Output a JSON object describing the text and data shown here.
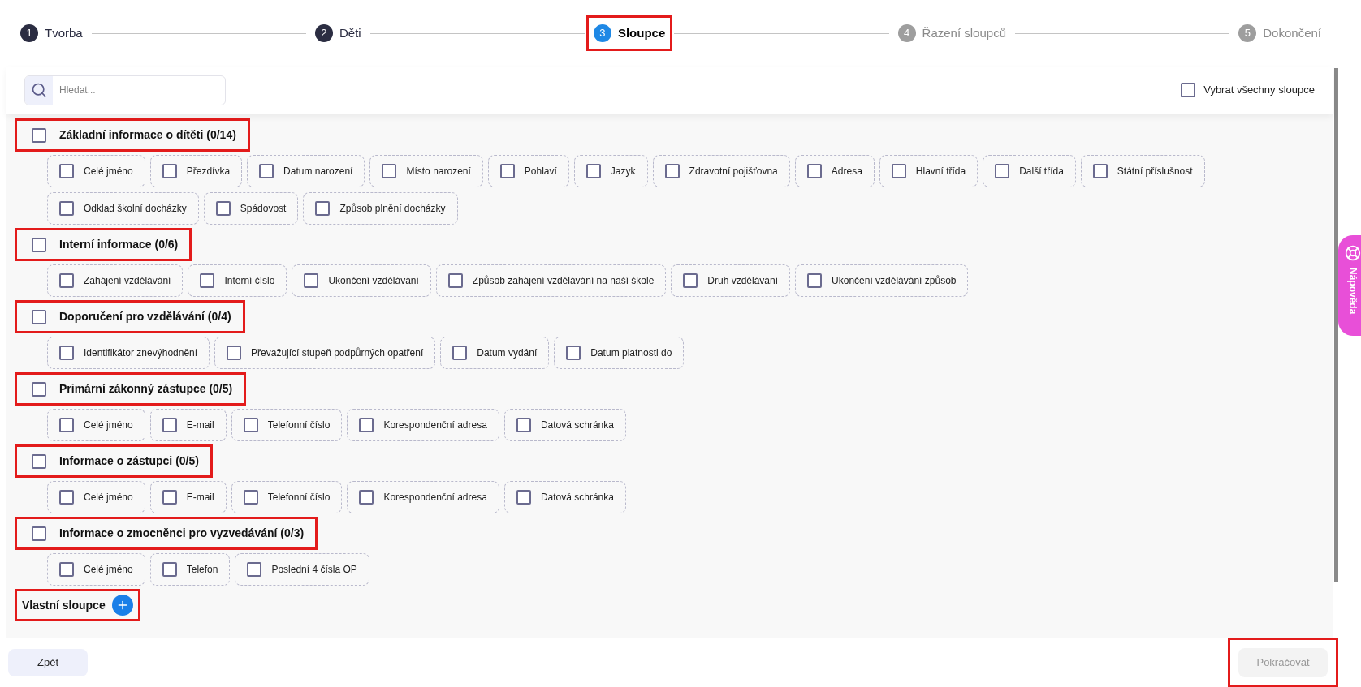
{
  "steps": [
    {
      "number": "1",
      "label": "Tvorba",
      "kind": "done",
      "highlighted": false
    },
    {
      "number": "2",
      "label": "Děti",
      "kind": "done",
      "highlighted": false
    },
    {
      "number": "3",
      "label": "Sloupce",
      "kind": "active",
      "highlighted": true
    },
    {
      "number": "4",
      "label": "Řazení sloupců",
      "kind": "pending",
      "highlighted": false
    },
    {
      "number": "5",
      "label": "Dokončení",
      "kind": "pending",
      "highlighted": false
    }
  ],
  "search": {
    "placeholder": "Hledat..."
  },
  "select_all": {
    "label": "Vybrat všechny sloupce",
    "checked": false
  },
  "sections": [
    {
      "title": "Základní informace o dítěti (0/14)",
      "checked": false,
      "highlighted": true,
      "columns": [
        {
          "label": "Celé jméno",
          "checked": false
        },
        {
          "label": "Přezdívka",
          "checked": false
        },
        {
          "label": "Datum narození",
          "checked": false
        },
        {
          "label": "Místo narození",
          "checked": false
        },
        {
          "label": "Pohlaví",
          "checked": false
        },
        {
          "label": "Jazyk",
          "checked": false
        },
        {
          "label": "Zdravotní pojišťovna",
          "checked": false
        },
        {
          "label": "Adresa",
          "checked": false
        },
        {
          "label": "Hlavní třída",
          "checked": false
        },
        {
          "label": "Další třída",
          "checked": false
        },
        {
          "label": "Státní příslušnost",
          "checked": false
        },
        {
          "label": "Odklad školní docházky",
          "checked": false
        },
        {
          "label": "Spádovost",
          "checked": false
        },
        {
          "label": "Způsob plnění docházky",
          "checked": false
        }
      ]
    },
    {
      "title": "Interní informace (0/6)",
      "checked": false,
      "highlighted": true,
      "columns": [
        {
          "label": "Zahájení vzdělávání",
          "checked": false
        },
        {
          "label": "Interní číslo",
          "checked": false
        },
        {
          "label": "Ukončení vzdělávání",
          "checked": false
        },
        {
          "label": "Způsob zahájení vzdělávání na naší škole",
          "checked": false
        },
        {
          "label": "Druh vzdělávání",
          "checked": false
        },
        {
          "label": "Ukončení vzdělávání způsob",
          "checked": false
        }
      ]
    },
    {
      "title": "Doporučení pro vzdělávání (0/4)",
      "checked": false,
      "highlighted": true,
      "columns": [
        {
          "label": "Identifikátor znevýhodnění",
          "checked": false
        },
        {
          "label": "Převažující stupeň podpůrných opatření",
          "checked": false
        },
        {
          "label": "Datum vydání",
          "checked": false
        },
        {
          "label": "Datum platnosti do",
          "checked": false
        }
      ]
    },
    {
      "title": "Primární zákonný zástupce (0/5)",
      "checked": false,
      "highlighted": true,
      "columns": [
        {
          "label": "Celé jméno",
          "checked": false
        },
        {
          "label": "E-mail",
          "checked": false
        },
        {
          "label": "Telefonní číslo",
          "checked": false
        },
        {
          "label": "Korespondenční adresa",
          "checked": false
        },
        {
          "label": "Datová schránka",
          "checked": false
        }
      ]
    },
    {
      "title": "Informace o zástupci (0/5)",
      "checked": false,
      "highlighted": true,
      "columns": [
        {
          "label": "Celé jméno",
          "checked": false
        },
        {
          "label": "E-mail",
          "checked": false
        },
        {
          "label": "Telefonní číslo",
          "checked": false
        },
        {
          "label": "Korespondenční adresa",
          "checked": false
        },
        {
          "label": "Datová schránka",
          "checked": false
        }
      ]
    },
    {
      "title": "Informace o zmocněnci pro vyzvedávání (0/3)",
      "checked": false,
      "highlighted": true,
      "columns": [
        {
          "label": "Celé jméno",
          "checked": false
        },
        {
          "label": "Telefon",
          "checked": false
        },
        {
          "label": "Poslední 4 čísla OP",
          "checked": false
        }
      ]
    }
  ],
  "custom_columns": {
    "title": "Vlastní sloupce",
    "highlighted": true
  },
  "help_tab": {
    "label": "Nápověda"
  },
  "back_button": {
    "label": "Zpět"
  },
  "continue_button": {
    "label": "Pokračovat",
    "disabled": true,
    "highlighted": true
  }
}
